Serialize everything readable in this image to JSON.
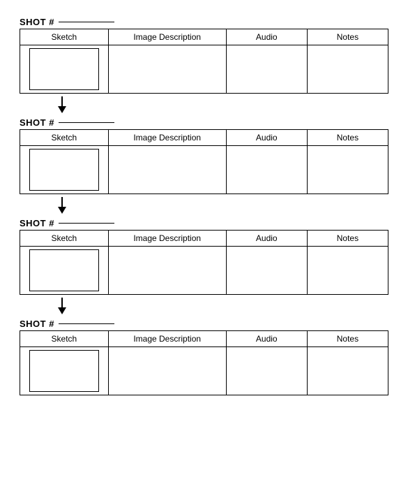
{
  "shots": [
    {
      "id": "shot1",
      "label": "SHOT #",
      "columns": [
        "Sketch",
        "Image Description",
        "Audio",
        "Notes"
      ],
      "has_arrow": true
    },
    {
      "id": "shot2",
      "label": "SHOT #",
      "columns": [
        "Sketch",
        "Image Description",
        "Audio",
        "Notes"
      ],
      "has_arrow": true
    },
    {
      "id": "shot3",
      "label": "SHOT #",
      "columns": [
        "Sketch",
        "Image Description",
        "Audio",
        "Notes"
      ],
      "has_arrow": true
    },
    {
      "id": "shot4",
      "label": "SHOT #",
      "columns": [
        "Sketch",
        "Image Description",
        "Audio",
        "Notes"
      ],
      "has_arrow": false
    }
  ]
}
